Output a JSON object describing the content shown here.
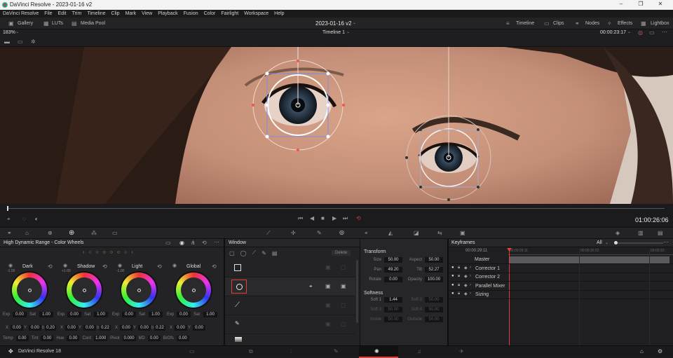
{
  "window": {
    "title": "DaVinci Resolve - 2023-01-16 v2"
  },
  "menu": [
    "DaVinci Resolve",
    "File",
    "Edit",
    "Trim",
    "Timeline",
    "Clip",
    "Mark",
    "View",
    "Playback",
    "Fusion",
    "Color",
    "Fairlight",
    "Workspace",
    "Help"
  ],
  "toolbar": {
    "gallery": "Gallery",
    "luts": "LUTs",
    "media_pool": "Media Pool",
    "project": "2023-01-16 v2",
    "timeline_btn": "Timeline",
    "clips": "Clips",
    "nodes": "Nodes",
    "effects": "Effects",
    "lightbox": "Lightbox"
  },
  "viewer_bar": {
    "zoom": "183%",
    "timeline_name": "Timeline 1",
    "timecode": "00:00:23:17"
  },
  "transport": {
    "timecode": "01:00:26:06"
  },
  "colorwheels": {
    "title": "High Dynamic Range - Color Wheels",
    "wheels": [
      {
        "name": "Dark",
        "exp": "0.00",
        "sat": "1.00",
        "x": "0.00",
        "y": "0.00",
        "z": "0.20",
        "zlabel": "b",
        "top": "-1.00"
      },
      {
        "name": "Shadow",
        "exp": "0.00",
        "sat": "1.00",
        "x": "0.00",
        "y": "0.00",
        "z": "0.22",
        "zlabel": "b",
        "top": "+1.00"
      },
      {
        "name": "Light",
        "exp": "0.00",
        "sat": "1.00",
        "x": "0.00",
        "y": "0.00",
        "z": "0.22",
        "zlabel": "b",
        "top": "-1.00"
      },
      {
        "name": "Global",
        "exp": "0.00",
        "sat": "1.00",
        "x": "0.00",
        "y": "0.00",
        "z": "",
        "zlabel": "",
        "top": ""
      }
    ],
    "lbl_exp": "Exp",
    "lbl_sat": "Sat",
    "lbl_x": "X",
    "lbl_y": "Y",
    "bottom": [
      {
        "label": "Temp",
        "value": "0.00"
      },
      {
        "label": "Tint",
        "value": "0.00"
      },
      {
        "label": "Hue",
        "value": "0.00"
      },
      {
        "label": "Cont",
        "value": "1.000"
      },
      {
        "label": "Pivot",
        "value": "0.000"
      },
      {
        "label": "MD",
        "value": "0.00"
      },
      {
        "label": "B/Ofs",
        "value": "0.00"
      }
    ]
  },
  "window_panel": {
    "title": "Window",
    "delete": "Delete",
    "transform": {
      "title": "Transform",
      "size": "50.00",
      "aspect": "50.00",
      "pan": "49.20",
      "tilt": "52.27",
      "rotate": "0.00",
      "opacity": "100.00",
      "lbl_size": "Size",
      "lbl_aspect": "Aspect",
      "lbl_pan": "Pan",
      "lbl_tilt": "Tilt",
      "lbl_rotate": "Rotate",
      "lbl_opacity": "Opacity"
    },
    "softness": {
      "title": "Softness",
      "soft1": "1.44",
      "soft2": "50.00",
      "soft3": "50.00",
      "soft4": "50.00",
      "inside": "50.00",
      "outside": "50.00",
      "lbl_soft1": "Soft 1",
      "lbl_soft2": "Soft 2",
      "lbl_soft3": "Soft 3",
      "lbl_soft4": "Soft 4",
      "lbl_inside": "Inside",
      "lbl_outside": "Outside"
    }
  },
  "keyframes": {
    "title": "Keyframes",
    "filter": "All",
    "timecode": "00:00:29:11",
    "ticks": [
      "00:00:29:11",
      "00:00:30:22",
      "00:00:32:"
    ],
    "tracks": [
      "Master",
      "Corrector 1",
      "Corrector 2",
      "Parallel Mixer",
      "Sizing"
    ]
  },
  "bottom": {
    "app": "DaVinci Resolve 18"
  },
  "colors": {
    "accent": "#e33b3b",
    "panel": "#232325"
  }
}
